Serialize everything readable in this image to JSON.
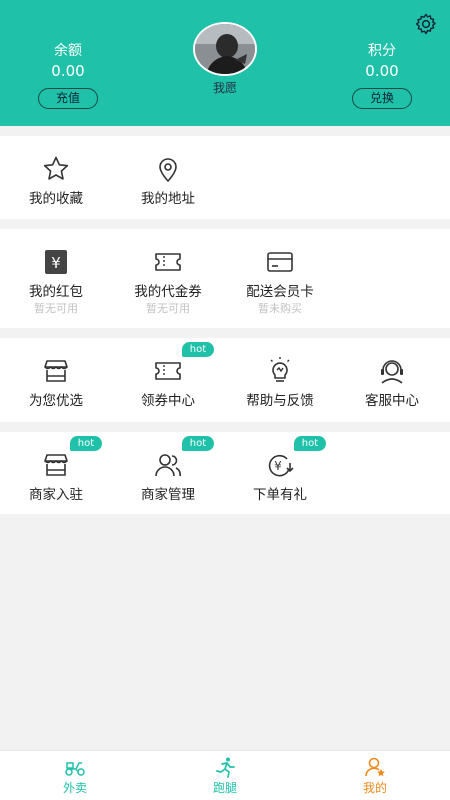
{
  "header": {
    "balance": {
      "label": "余额",
      "value": "0.00",
      "button": "充值"
    },
    "points": {
      "label": "积分",
      "value": "0.00",
      "button": "兑换"
    },
    "nickname": "我愿",
    "settings_icon": "gear-icon"
  },
  "section1": {
    "items": [
      {
        "label": "我的收藏",
        "icon": "star-icon"
      },
      {
        "label": "我的地址",
        "icon": "location-pin-icon"
      }
    ]
  },
  "section2": {
    "items": [
      {
        "label": "我的红包",
        "sub": "暂无可用",
        "icon": "red-packet-icon"
      },
      {
        "label": "我的代金券",
        "sub": "暂无可用",
        "icon": "voucher-icon"
      },
      {
        "label": "配送会员卡",
        "sub": "暂未购买",
        "icon": "card-icon"
      }
    ]
  },
  "section3": {
    "items": [
      {
        "label": "为您优选",
        "icon": "store-icon",
        "badge": ""
      },
      {
        "label": "领券中心",
        "icon": "ticket-icon",
        "badge": "hot"
      },
      {
        "label": "帮助与反馈",
        "icon": "lightbulb-icon",
        "badge": ""
      },
      {
        "label": "客服中心",
        "icon": "headset-icon",
        "badge": ""
      }
    ]
  },
  "section4": {
    "items": [
      {
        "label": "商家入驻",
        "icon": "store-icon",
        "badge": "hot"
      },
      {
        "label": "商家管理",
        "icon": "users-icon",
        "badge": "hot"
      },
      {
        "label": "下单有礼",
        "icon": "yuan-coin-icon",
        "badge": "hot"
      }
    ]
  },
  "tabbar": {
    "tabs": [
      {
        "label": "外卖",
        "icon": "scooter-icon"
      },
      {
        "label": "跑腿",
        "icon": "runner-icon"
      },
      {
        "label": "我的",
        "icon": "profile-icon",
        "active": true
      }
    ]
  },
  "colors": {
    "primary": "#1fc1a8",
    "active_tab": "#f08a1c",
    "subtext": "#c2c2c2",
    "background": "#f2f2f2"
  }
}
